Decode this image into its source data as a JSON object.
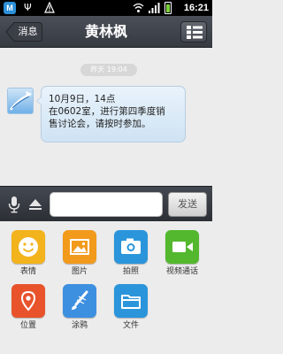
{
  "status_bar": {
    "time": "16:21",
    "icons": [
      "app-notification-icon",
      "usb-icon",
      "warning-icon",
      "wifi-icon",
      "signal-icon",
      "battery-charging-icon"
    ]
  },
  "header": {
    "back_label": "消息",
    "title": "黄林枫",
    "menu_icon": "menu-icon"
  },
  "chat": {
    "timestamp": "昨天 19:04",
    "messages": [
      {
        "direction": "incoming",
        "lines": [
          "10月9日，14点",
          "在0602室，进行第四季度销",
          "售讨论会，请按时参加。"
        ]
      }
    ]
  },
  "input_bar": {
    "text_value": "",
    "send_label": "发送"
  },
  "attachments": [
    {
      "label": "表情",
      "icon": "emoji-icon",
      "color": "#f2b31c"
    },
    {
      "label": "图片",
      "icon": "picture-icon",
      "color": "#f29a1c"
    },
    {
      "label": "拍照",
      "icon": "camera-icon",
      "color": "#2b95db"
    },
    {
      "label": "视频通话",
      "icon": "video-call-icon",
      "color": "#53b82d"
    },
    {
      "label": "位置",
      "icon": "location-icon",
      "color": "#e8532b"
    },
    {
      "label": "涂鸦",
      "icon": "doodle-icon",
      "color": "#3d8fe0"
    },
    {
      "label": "文件",
      "icon": "file-icon",
      "color": "#2b95db"
    }
  ]
}
